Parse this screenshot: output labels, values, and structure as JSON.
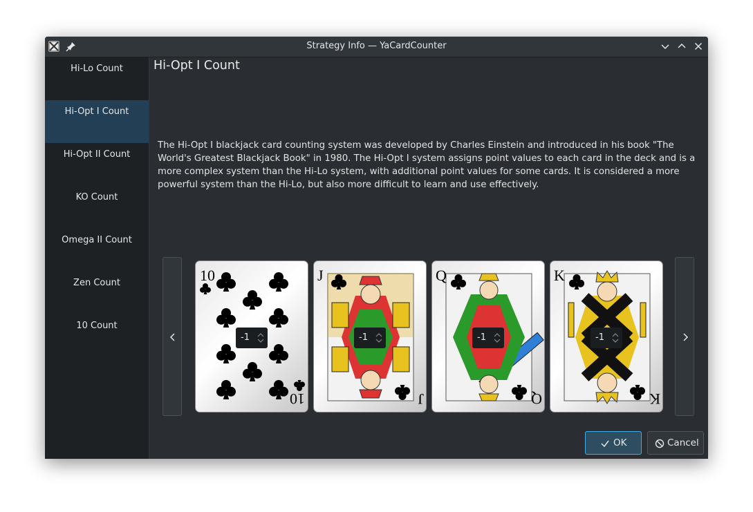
{
  "window": {
    "title": "Strategy Info — YaCardCounter"
  },
  "sidebar": {
    "items": [
      {
        "label": "Hi-Lo Count"
      },
      {
        "label": "Hi-Opt I Count"
      },
      {
        "label": "Hi-Opt II Count"
      },
      {
        "label": "KO Count"
      },
      {
        "label": "Omega II Count"
      },
      {
        "label": "Zen Count"
      },
      {
        "label": "10 Count"
      }
    ],
    "selected_index": 1
  },
  "content": {
    "heading": "Hi-Opt I Count",
    "description": "The Hi-Opt I blackjack card counting system was developed by Charles Einstein and introduced in his book \"The World's Greatest Blackjack Book\" in 1980. The Hi-Opt I system assigns point values to each card in the deck and is a more complex system than the Hi-Lo system, with additional point values for some cards. It is considered a more powerful system than the Hi-Lo, but also more difficult to learn and use effectively.",
    "cards": [
      {
        "rank": "10",
        "suit": "clubs",
        "count_value": "-1"
      },
      {
        "rank": "J",
        "suit": "clubs",
        "count_value": "-1"
      },
      {
        "rank": "Q",
        "suit": "clubs",
        "count_value": "-1"
      },
      {
        "rank": "K",
        "suit": "clubs",
        "count_value": "-1"
      }
    ]
  },
  "buttons": {
    "ok": "OK",
    "cancel": "Cancel"
  },
  "icons": {
    "app": "app-icon",
    "pin": "pin-icon",
    "minimize": "chevron-down-icon",
    "maximize": "chevron-up-icon",
    "close": "close-icon",
    "prev": "chevron-left-icon",
    "next": "chevron-right-icon",
    "ok": "checkmark-icon",
    "cancel": "cancel-icon"
  },
  "colors": {
    "accent": "#3daee9",
    "selection": "#233f56",
    "background": "#2a2e32",
    "sidebar": "#1e2124"
  }
}
